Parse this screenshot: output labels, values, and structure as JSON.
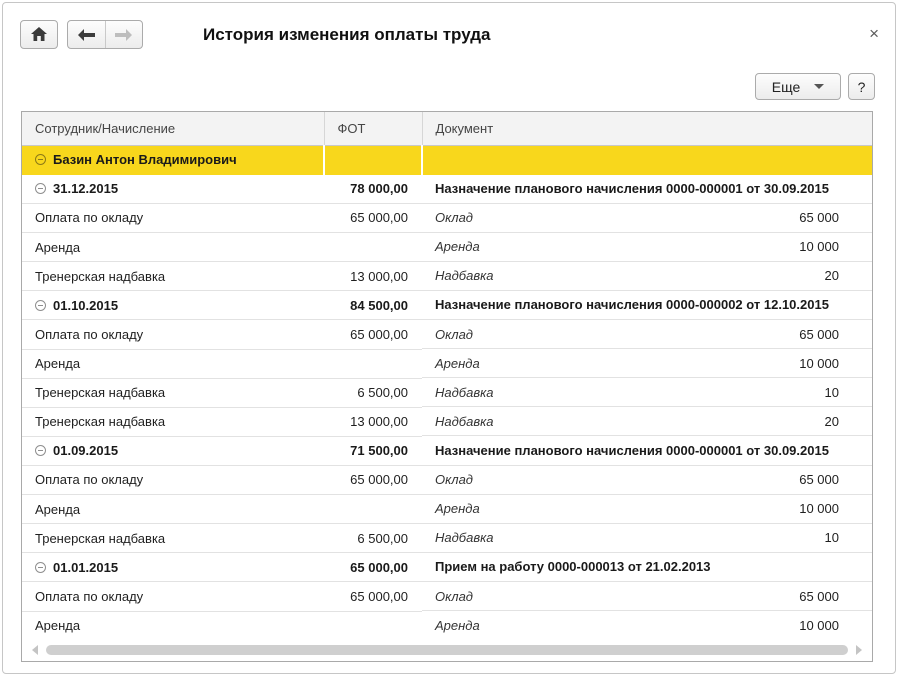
{
  "window": {
    "title": "История изменения оплаты труда",
    "close_glyph": "×"
  },
  "toolbar": {
    "more_label": "Еще",
    "help_label": "?"
  },
  "icons": {
    "home": "home-icon",
    "back": "arrow-left-icon",
    "forward": "arrow-right-icon",
    "more_dropdown": "chevron-down-icon",
    "close": "close-icon"
  },
  "colors": {
    "selection_yellow": "#f8d71c",
    "header_bg": "#f3f3f3",
    "grid_border": "#a9a9a9"
  },
  "table": {
    "columns": [
      "Сотрудник/Начисление",
      "ФОТ",
      "Документ"
    ],
    "employee": "Базин Антон Владимирович",
    "groups": [
      {
        "date": "31.12.2015",
        "fot": "78 000,00",
        "document": "Назначение планового начисления 0000-000001 от 30.09.2015",
        "rows": [
          {
            "name": "Оплата по окладу",
            "fot": "65 000,00",
            "indicator": "Оклад",
            "value": "65 000"
          },
          {
            "name": "Аренда",
            "fot": "",
            "indicator": "Аренда",
            "value": "10 000"
          },
          {
            "name": "Тренерская надбавка",
            "fot": "13 000,00",
            "indicator": "Надбавка",
            "value": "20"
          }
        ]
      },
      {
        "date": "01.10.2015",
        "fot": "84 500,00",
        "document": "Назначение планового начисления 0000-000002 от 12.10.2015",
        "rows": [
          {
            "name": "Оплата по окладу",
            "fot": "65 000,00",
            "indicator": "Оклад",
            "value": "65 000"
          },
          {
            "name": "Аренда",
            "fot": "",
            "indicator": "Аренда",
            "value": "10 000"
          },
          {
            "name": "Тренерская надбавка",
            "fot": "6 500,00",
            "indicator": "Надбавка",
            "value": "10"
          },
          {
            "name": "Тренерская надбавка",
            "fot": "13 000,00",
            "indicator": "Надбавка",
            "value": "20"
          }
        ]
      },
      {
        "date": "01.09.2015",
        "fot": "71 500,00",
        "document": "Назначение планового начисления 0000-000001 от 30.09.2015",
        "rows": [
          {
            "name": "Оплата по окладу",
            "fot": "65 000,00",
            "indicator": "Оклад",
            "value": "65 000"
          },
          {
            "name": "Аренда",
            "fot": "",
            "indicator": "Аренда",
            "value": "10 000"
          },
          {
            "name": "Тренерская надбавка",
            "fot": "6 500,00",
            "indicator": "Надбавка",
            "value": "10"
          }
        ]
      },
      {
        "date": "01.01.2015",
        "fot": "65 000,00",
        "document": "Прием на работу 0000-000013 от 21.02.2013",
        "rows": [
          {
            "name": "Оплата по окладу",
            "fot": "65 000,00",
            "indicator": "Оклад",
            "value": "65 000"
          },
          {
            "name": "Аренда",
            "fot": "",
            "indicator": "Аренда",
            "value": "10 000"
          }
        ]
      }
    ]
  }
}
